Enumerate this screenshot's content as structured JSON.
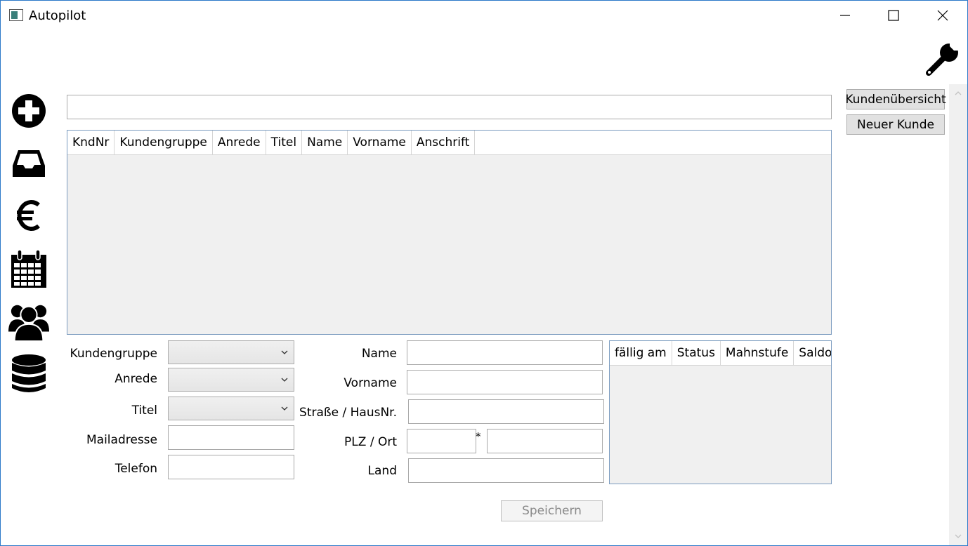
{
  "window": {
    "title": "Autopilot",
    "minimize_icon": "minimize-icon",
    "maximize_icon": "maximize-icon",
    "close_icon": "close-icon"
  },
  "toolbar": {
    "settings_icon": "wrench-icon"
  },
  "sidebar": {
    "items": [
      {
        "icon": "plus-circle-icon"
      },
      {
        "icon": "inbox-icon"
      },
      {
        "icon": "euro-icon"
      },
      {
        "icon": "calendar-icon"
      },
      {
        "icon": "users-icon"
      },
      {
        "icon": "database-icon"
      }
    ]
  },
  "search": {
    "value": "",
    "placeholder": ""
  },
  "customer_table": {
    "columns": [
      "KndNr",
      "Kundengruppe",
      "Anrede",
      "Titel",
      "Name",
      "Vorname",
      "Anschrift"
    ],
    "rows": []
  },
  "form": {
    "kundengruppe_label": "Kundengruppe",
    "anrede_label": "Anrede",
    "titel_label": "Titel",
    "mail_label": "Mailadresse",
    "telefon_label": "Telefon",
    "name_label": "Name",
    "vorname_label": "Vorname",
    "strasse_label": "Straße / HausNr.",
    "plz_ort_label": "PLZ / Ort",
    "plz_separator": "*",
    "land_label": "Land",
    "kundengruppe_value": "",
    "anrede_value": "",
    "titel_value": "",
    "mail_value": "",
    "telefon_value": "",
    "name_value": "",
    "vorname_value": "",
    "strasse_value": "",
    "plz_value": "",
    "ort_value": "",
    "land_value": ""
  },
  "invoice_table": {
    "columns": [
      "fällig am",
      "Status",
      "Mahnstufe",
      "Saldo"
    ],
    "rows": []
  },
  "actions": {
    "save_label": "Speichern",
    "customer_overview_label": "Kundenübersicht",
    "new_customer_label": "Neuer Kunde"
  }
}
